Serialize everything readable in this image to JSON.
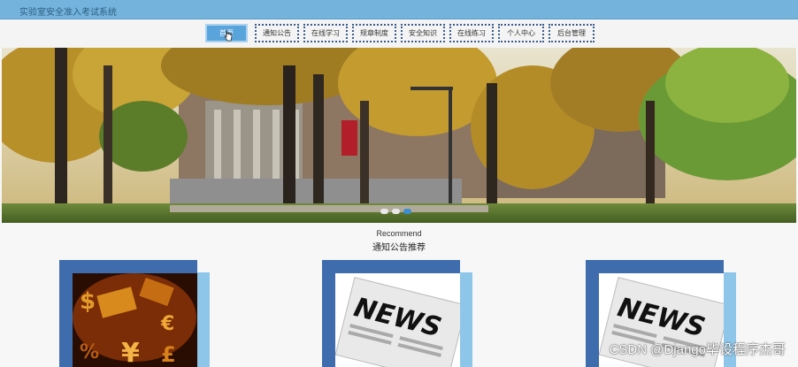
{
  "app": {
    "title": "实验室安全准入考试系统"
  },
  "nav": {
    "items": [
      {
        "label": "首页",
        "active": true
      },
      {
        "label": "通知公告"
      },
      {
        "label": "在线学习"
      },
      {
        "label": "规章制度"
      },
      {
        "label": "安全知识"
      },
      {
        "label": "在线练习"
      },
      {
        "label": "个人中心"
      },
      {
        "label": "后台管理"
      }
    ]
  },
  "carousel": {
    "slides": 3,
    "active_slide": 3
  },
  "recommend": {
    "heading_en": "Recommend",
    "heading_zh": "通知公告推荐",
    "cards": [
      {
        "image": "currency-symbols"
      },
      {
        "image": "news-newspaper",
        "text": "NEWS"
      },
      {
        "image": "news-newspaper",
        "text": "NEWS"
      }
    ]
  },
  "watermark": "CSDN @Django毕设程序杰哥",
  "colors": {
    "accent": "#74b3dc",
    "nav_border": "#3a5c8e",
    "active": "#5aa4dc",
    "card_back": "#3f6cad",
    "card_side": "#8ec6ea"
  }
}
